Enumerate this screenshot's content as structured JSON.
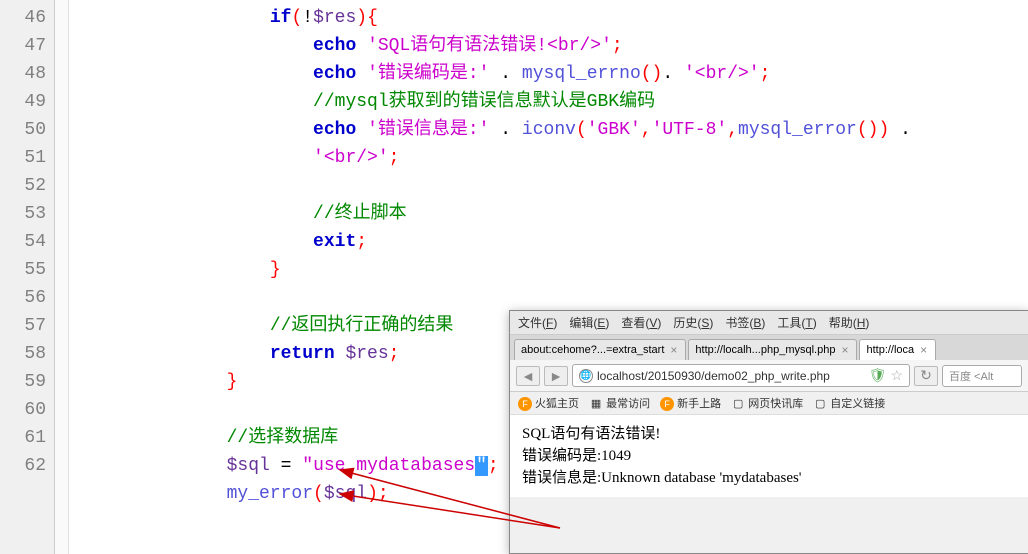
{
  "editor": {
    "lines": [
      {
        "num": 46,
        "indent": 4,
        "parts": [
          {
            "t": "kw",
            "v": "if"
          },
          {
            "t": "punc",
            "v": "("
          },
          {
            "t": "op",
            "v": "!"
          },
          {
            "t": "var",
            "v": "$res"
          },
          {
            "t": "punc",
            "v": ")"
          },
          {
            "t": "punc",
            "v": "{"
          }
        ]
      },
      {
        "num": 47,
        "indent": 5,
        "parts": [
          {
            "t": "kw",
            "v": "echo"
          },
          {
            "t": "",
            "v": " "
          },
          {
            "t": "str",
            "v": "'SQL语句有语法错误!<br/>'"
          },
          {
            "t": "punc",
            "v": ";"
          }
        ]
      },
      {
        "num": 48,
        "indent": 5,
        "parts": [
          {
            "t": "kw",
            "v": "echo"
          },
          {
            "t": "",
            "v": " "
          },
          {
            "t": "str",
            "v": "'错误编码是:'"
          },
          {
            "t": "",
            "v": " "
          },
          {
            "t": "op",
            "v": "."
          },
          {
            "t": "",
            "v": " "
          },
          {
            "t": "fn",
            "v": "mysql_errno"
          },
          {
            "t": "punc",
            "v": "()"
          },
          {
            "t": "op",
            "v": "."
          },
          {
            "t": "",
            "v": " "
          },
          {
            "t": "str",
            "v": "'<br/>'"
          },
          {
            "t": "punc",
            "v": ";"
          }
        ]
      },
      {
        "num": 49,
        "indent": 5,
        "parts": [
          {
            "t": "cmt",
            "v": "//mysql获取到的错误信息默认是GBK编码"
          }
        ]
      },
      {
        "num": 50,
        "indent": 5,
        "parts": [
          {
            "t": "kw",
            "v": "echo"
          },
          {
            "t": "",
            "v": " "
          },
          {
            "t": "str",
            "v": "'错误信息是:'"
          },
          {
            "t": "",
            "v": " "
          },
          {
            "t": "op",
            "v": "."
          },
          {
            "t": "",
            "v": " "
          },
          {
            "t": "fn",
            "v": "iconv"
          },
          {
            "t": "punc",
            "v": "("
          },
          {
            "t": "str",
            "v": "'GBK'"
          },
          {
            "t": "punc",
            "v": ","
          },
          {
            "t": "str",
            "v": "'UTF-8'"
          },
          {
            "t": "punc",
            "v": ","
          },
          {
            "t": "fn",
            "v": "mysql_error"
          },
          {
            "t": "punc",
            "v": "())"
          },
          {
            "t": "",
            "v": " "
          },
          {
            "t": "op",
            "v": "."
          }
        ]
      },
      {
        "num": "",
        "indent": 5,
        "parts": [
          {
            "t": "str",
            "v": "'<br/>'"
          },
          {
            "t": "punc",
            "v": ";"
          }
        ]
      },
      {
        "num": 51,
        "indent": 0,
        "parts": []
      },
      {
        "num": 52,
        "indent": 5,
        "parts": [
          {
            "t": "cmt",
            "v": "//终止脚本"
          }
        ]
      },
      {
        "num": 53,
        "indent": 5,
        "parts": [
          {
            "t": "kw",
            "v": "exit"
          },
          {
            "t": "punc",
            "v": ";"
          }
        ]
      },
      {
        "num": 54,
        "indent": 4,
        "parts": [
          {
            "t": "punc",
            "v": "}"
          }
        ]
      },
      {
        "num": 55,
        "indent": 0,
        "parts": []
      },
      {
        "num": 56,
        "indent": 4,
        "parts": [
          {
            "t": "cmt",
            "v": "//返回执行正确的结果"
          }
        ]
      },
      {
        "num": 57,
        "indent": 4,
        "parts": [
          {
            "t": "kw",
            "v": "return"
          },
          {
            "t": "",
            "v": " "
          },
          {
            "t": "var",
            "v": "$res"
          },
          {
            "t": "punc",
            "v": ";"
          }
        ]
      },
      {
        "num": 58,
        "indent": 3,
        "parts": [
          {
            "t": "punc",
            "v": "}"
          }
        ]
      },
      {
        "num": 59,
        "indent": 0,
        "parts": []
      },
      {
        "num": 60,
        "indent": 3,
        "parts": [
          {
            "t": "cmt",
            "v": "//选择数据库"
          }
        ]
      },
      {
        "num": 61,
        "indent": 3,
        "parts": [
          {
            "t": "var",
            "v": "$sql"
          },
          {
            "t": "",
            "v": " "
          },
          {
            "t": "op",
            "v": "="
          },
          {
            "t": "",
            "v": " "
          },
          {
            "t": "str",
            "v": "\"use mydatabases"
          },
          {
            "t": "caret",
            "v": "\""
          },
          {
            "t": "punc",
            "v": ";"
          }
        ]
      },
      {
        "num": 62,
        "indent": 3,
        "parts": [
          {
            "t": "fn",
            "v": "my_error"
          },
          {
            "t": "punc",
            "v": "("
          },
          {
            "t": "var",
            "v": "$sql"
          },
          {
            "t": "punc",
            "v": ")"
          },
          {
            "t": "punc",
            "v": ";"
          }
        ]
      }
    ]
  },
  "browser": {
    "menubar": [
      "文件(F)",
      "编辑(E)",
      "查看(V)",
      "历史(S)",
      "书签(B)",
      "工具(T)",
      "帮助(H)"
    ],
    "tabs": [
      {
        "label": "about:cehome?...=extra_start",
        "active": false
      },
      {
        "label": "http://localh...php_mysql.php",
        "active": false
      },
      {
        "label": "http://loca",
        "active": true
      }
    ],
    "url": "localhost/20150930/demo02_php_write.php",
    "search_placeholder": "百度 <Alt",
    "bookmarks": [
      "火狐主页",
      "最常访问",
      "新手上路",
      "网页快讯库",
      "自定义链接"
    ],
    "content_lines": [
      "SQL语句有语法错误!",
      "错误编码是:1049",
      "错误信息是:Unknown database 'mydatabases'"
    ]
  }
}
